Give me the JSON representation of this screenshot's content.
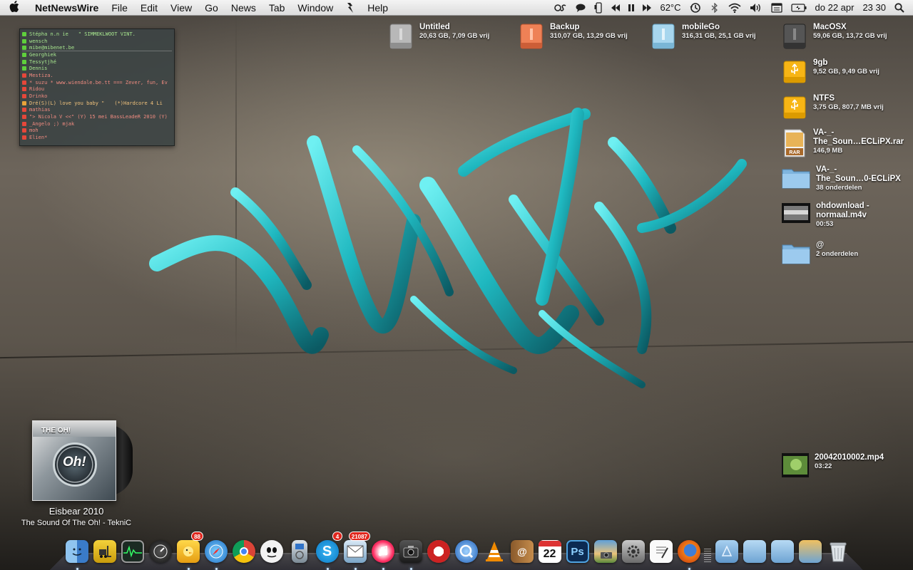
{
  "menubar": {
    "app_name": "NetNewsWire",
    "menus": [
      "File",
      "Edit",
      "View",
      "Go",
      "News",
      "Tab",
      "Window",
      "Help"
    ],
    "temperature": "62°C",
    "date": "do 22 apr",
    "time": "23 30",
    "status_icons": [
      "cs-icon",
      "chat-bubble-icon",
      "phone-icon",
      "previous-track-icon",
      "pause-icon",
      "next-track-icon",
      "time-machine-icon",
      "bluetooth-icon",
      "wifi-icon",
      "volume-icon",
      "calendar-icon",
      "battery-icon",
      "spotlight-icon"
    ]
  },
  "chat": {
    "contacts": [
      {
        "name": "Stépha n.n ie",
        "extra": "\"  SIMMEKLWOOT VINT.",
        "status": "green"
      },
      {
        "name": "wensch",
        "extra": "",
        "status": "green"
      },
      {
        "name": "mibe@mibenet.be",
        "extra": "",
        "status": "green"
      },
      {
        "name": "Georghiek",
        "extra": "",
        "status": "green"
      },
      {
        "name": "Tessytjhé",
        "extra": "",
        "status": "green"
      },
      {
        "name": "Dennis",
        "extra": "",
        "status": "green"
      },
      {
        "name": "Mestiza.",
        "extra": "",
        "status": "red"
      },
      {
        "name": "* suzu * www.wiendale.be.tt === Zever, fun, Ev",
        "extra": "",
        "status": "red"
      },
      {
        "name": "Ridou",
        "extra": "",
        "status": "red"
      },
      {
        "name": "Drinko",
        "extra": "",
        "status": "red"
      },
      {
        "name": "Dré(S)(L) love you baby \"",
        "extra": "(*)Hardcore 4 Li",
        "status": "orange"
      },
      {
        "name": "mathias",
        "extra": "",
        "status": "red"
      },
      {
        "name": "\"> Nicola V <<\" (Y) 15 mei  BassLeadeR 2010 (Y)",
        "extra": "",
        "status": "red"
      },
      {
        "name": "_Angelo  ;) mjak",
        "extra": "",
        "status": "red"
      },
      {
        "name": "moh",
        "extra": "",
        "status": "red"
      },
      {
        "name": "Elien*",
        "extra": "",
        "status": "red"
      }
    ]
  },
  "desktop": {
    "untitled": {
      "name": "Untitled",
      "sub": "20,63 GB, 7,09 GB vrij"
    },
    "backup": {
      "name": "Backup",
      "sub": "310,07 GB, 13,29 GB vrij"
    },
    "mobilego": {
      "name": "mobileGo",
      "sub": "316,31 GB, 25,1 GB vrij"
    },
    "macosx": {
      "name": "MacOSX",
      "sub": "59,06 GB, 13,72 GB vrij"
    },
    "9gb": {
      "name": "9gb",
      "sub": "9,52 GB, 9,49 GB vrij"
    },
    "ntfs": {
      "name": "NTFS",
      "sub": "3,75 GB, 807,7 MB vrij"
    },
    "rar": {
      "name1": "VA-_-",
      "name2": "The_Soun…ECLiPX.rar",
      "sub": "146,9 MB",
      "label": "RAR"
    },
    "folder1": {
      "name1": "VA-_-",
      "name2": "The_Soun…0-ECLiPX",
      "sub": "38 onderdelen"
    },
    "video1": {
      "name1": "ohdownload -",
      "name2": "normaal.m4v",
      "sub": "00:53"
    },
    "folder2": {
      "name": "@",
      "sub": "2 onderdelen"
    },
    "video2": {
      "name": "20042010002.mp4",
      "sub": "03:22"
    }
  },
  "itunes": {
    "album_cover_title": "THE OH!",
    "album_logo": "Oh!",
    "track_title": "Eisbear 2010",
    "track_album": "The Sound Of The Oh! - TekniC"
  },
  "dock": {
    "badges": {
      "adium": "88",
      "skype": "4",
      "mail": "21087"
    },
    "calendar_day": "22",
    "ps_label": "Ps"
  },
  "colors": {
    "graffiti_teal": "#1fb8c0",
    "menubar_bg": "#e6e6e6",
    "badge_red": "#e0261d"
  }
}
